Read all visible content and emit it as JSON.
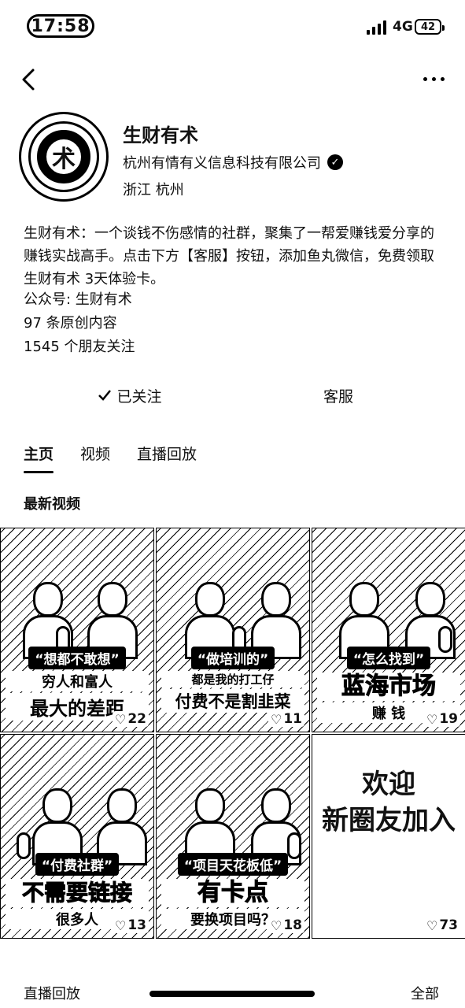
{
  "status": {
    "time": "17:58",
    "network": "4G",
    "battery": "42"
  },
  "profile": {
    "name": "生财有术",
    "company": "杭州有情有义信息科技有限公司",
    "location": "浙江 杭州",
    "avatar_glyph": "术",
    "bio": "生财有术：一个谈钱不伤感情的社群，聚集了一帮爱赚钱爱分享的赚钱实战高手。点击下方【客服】按钮，添加鱼丸微信，免费领取生财有术 3天体验卡。",
    "official_account": "公众号: 生财有术",
    "original_count": "97 条原创内容",
    "friends_following": "1545 个朋友关注"
  },
  "actions": {
    "follow": "已关注",
    "service": "客服"
  },
  "tabs": [
    {
      "label": "主页"
    },
    {
      "label": "视频"
    },
    {
      "label": "直播回放"
    }
  ],
  "section_title": "最新视频",
  "videos": [
    {
      "caption_top": "“想都不敢想”",
      "caption_main": "穷人和富人",
      "caption_sub": "最大的差距",
      "likes": "22"
    },
    {
      "caption_top": "“做培训的”",
      "caption_main": "都是我的打工仔",
      "caption_sub": "付费不是割韭菜",
      "likes": "11"
    },
    {
      "caption_top": "“怎么找到”",
      "caption_main": "蓝海市场",
      "caption_sub": "赚        钱",
      "likes": "19"
    },
    {
      "caption_top": "“付费社群”",
      "caption_main": "不需要链接",
      "caption_sub": "很多人",
      "likes": "13"
    },
    {
      "caption_top": "“项目天花板低”",
      "caption_main": "有卡点",
      "caption_sub": "要换项目吗？",
      "likes": "18"
    },
    {
      "welcome_line1": "欢迎",
      "welcome_line2": "新圈友加入",
      "likes": "73"
    }
  ],
  "footer": {
    "left": "直播回放",
    "right": "全部"
  },
  "icons": {
    "back": "chevron-left-icon",
    "more": "more-icon",
    "verified": "verified-icon",
    "heart": "heart-icon",
    "check": "check-icon"
  }
}
